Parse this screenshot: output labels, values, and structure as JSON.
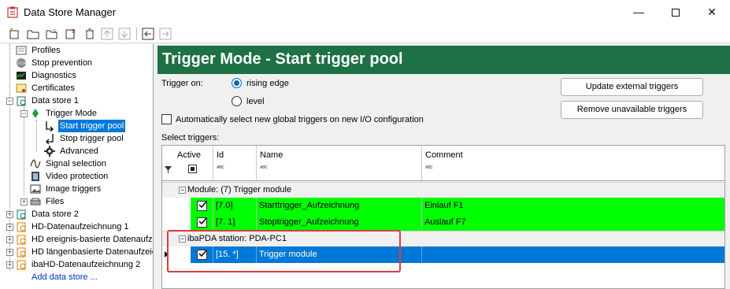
{
  "window": {
    "title": "Data Store Manager",
    "minimize": "—",
    "close": "✕"
  },
  "toolbar": {
    "icons": [
      "new-profile-icon",
      "open-folder-icon",
      "save-as-icon",
      "properties-icon",
      "delete-icon",
      "move-up-icon",
      "move-down-icon",
      "arrow-left-icon",
      "arrow-right-icon"
    ]
  },
  "tree": {
    "items": [
      {
        "label": "Profiles",
        "icon": "profiles-icon"
      },
      {
        "label": "Stop prevention",
        "icon": "stop-icon"
      },
      {
        "label": "Diagnostics",
        "icon": "diagnostics-icon"
      },
      {
        "label": "Certificates",
        "icon": "certificate-icon"
      },
      {
        "label": "Data store 1",
        "icon": "data-store-icon"
      },
      {
        "label": "Trigger Mode",
        "icon": "trigger-mode-icon"
      },
      {
        "label": "Start trigger pool",
        "icon": "start-trigger-icon"
      },
      {
        "label": "Stop trigger pool",
        "icon": "stop-trigger-icon"
      },
      {
        "label": "Advanced",
        "icon": "gear-icon"
      },
      {
        "label": "Signal selection",
        "icon": "signal-icon"
      },
      {
        "label": "Video protection",
        "icon": "film-icon"
      },
      {
        "label": "Image triggers",
        "icon": "image-icon"
      },
      {
        "label": "Files",
        "icon": "files-icon"
      },
      {
        "label": "Data store 2",
        "icon": "data-store-icon"
      },
      {
        "label": "HD-Datenaufzeichnung 1",
        "icon": "hd-store-icon"
      },
      {
        "label": "HD ereignis-basierte Datenaufzeichnung",
        "icon": "hd-store-icon"
      },
      {
        "label": "HD längenbasierte Datenaufzeichnung",
        "icon": "hd-store-icon"
      },
      {
        "label": "ibaHD-Datenaufzeichnung 2",
        "icon": "hd-store-icon"
      },
      {
        "label": "Add data store ...",
        "icon": ""
      }
    ]
  },
  "panel": {
    "title": "Trigger Mode - Start trigger pool",
    "trigger_on_label": "Trigger on:",
    "radio_rising": "rising edge",
    "radio_level": "level",
    "selected_trigger": "rising edge",
    "auto_select_label": "Automatically select new global triggers on new I/O configuration",
    "auto_select_checked": false,
    "select_triggers_label": "Select triggers:",
    "btn_update": "Update external triggers",
    "btn_remove": "Remove unavailable triggers"
  },
  "grid": {
    "columns": [
      {
        "name": "Active",
        "filter": "filter-checkbox"
      },
      {
        "name": "Id",
        "filter": "ABC"
      },
      {
        "name": "Name",
        "filter": "ABC"
      },
      {
        "name": "Comment",
        "filter": "ABC"
      }
    ],
    "groups": [
      {
        "label": "Module: (7) Trigger module",
        "rows": [
          {
            "active": true,
            "id": "[7.0]",
            "name": "Starttrigger_Aufzeichnung",
            "comment": "Einlauf F1"
          },
          {
            "active": true,
            "id": "[7. 1]",
            "name": "Stoptrigger_Aufzeichnung",
            "comment": "Auslauf F7"
          }
        ]
      },
      {
        "label": "ibaPDA station: PDA-PC1",
        "rows": [
          {
            "active": true,
            "id": "[15. *]",
            "name": "Trigger module",
            "comment": ""
          }
        ]
      }
    ]
  },
  "colors": {
    "header": "#1e7145",
    "green_row": "#00ff00",
    "selected_row": "#0078d7",
    "highlight": "#e03a3a"
  }
}
